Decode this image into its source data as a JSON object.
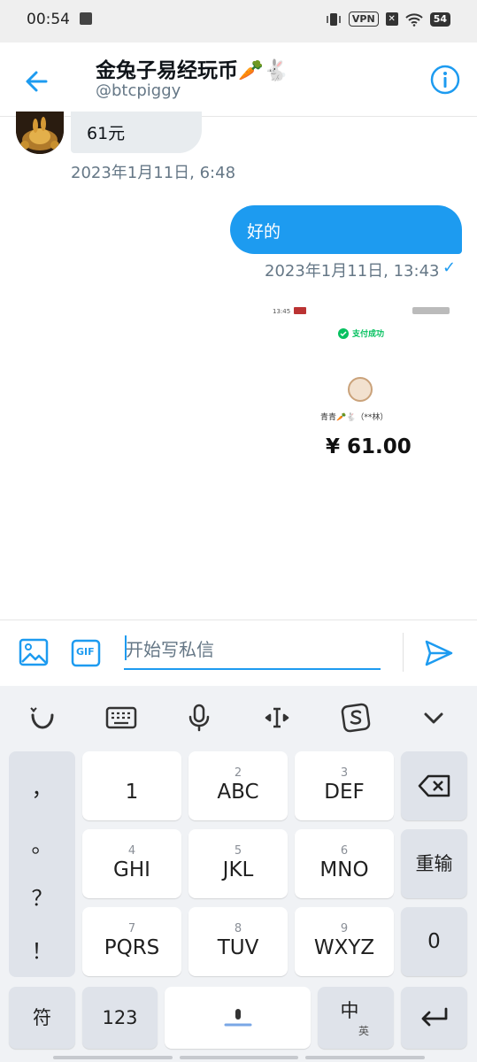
{
  "status_bar": {
    "time": "00:54",
    "vpn": "VPN",
    "battery": "54"
  },
  "header": {
    "title": "金兔子易经玩币",
    "title_emoji": "🥕🐇",
    "handle": "@btcpiggy"
  },
  "messages": {
    "incoming": {
      "text": "61元",
      "timestamp": "2023年1月11日, 6:48"
    },
    "outgoing": {
      "text": "好的",
      "timestamp": "2023年1月11日, 13:43",
      "read_mark": "✓"
    },
    "payment_image": {
      "status_time": "13:45",
      "status_text": "支付成功",
      "payer": "青青🥕🐇（**林）",
      "amount": "¥ 61.00"
    }
  },
  "composer": {
    "placeholder": "开始写私信",
    "gif_label": "GIF"
  },
  "keyboard": {
    "punctuation": [
      "，",
      "。",
      "？",
      "！"
    ],
    "rows": [
      {
        "keys": [
          {
            "sub": "",
            "main": "1"
          },
          {
            "sub": "2",
            "main": "ABC"
          },
          {
            "sub": "3",
            "main": "DEF"
          }
        ]
      },
      {
        "keys": [
          {
            "sub": "4",
            "main": "GHI"
          },
          {
            "sub": "5",
            "main": "JKL"
          },
          {
            "sub": "6",
            "main": "MNO"
          }
        ]
      },
      {
        "keys": [
          {
            "sub": "7",
            "main": "PQRS"
          },
          {
            "sub": "8",
            "main": "TUV"
          },
          {
            "sub": "9",
            "main": "WXYZ"
          }
        ]
      }
    ],
    "side": {
      "reinput": "重输",
      "zero": "0"
    },
    "bottom": {
      "symbols": "符",
      "numbers": "123",
      "lang_main": "中",
      "lang_sub": "英"
    }
  },
  "colors": {
    "accent": "#1d9bf0",
    "bubble_in": "#e8ecef",
    "keyboard_bg": "#f0f2f5"
  }
}
